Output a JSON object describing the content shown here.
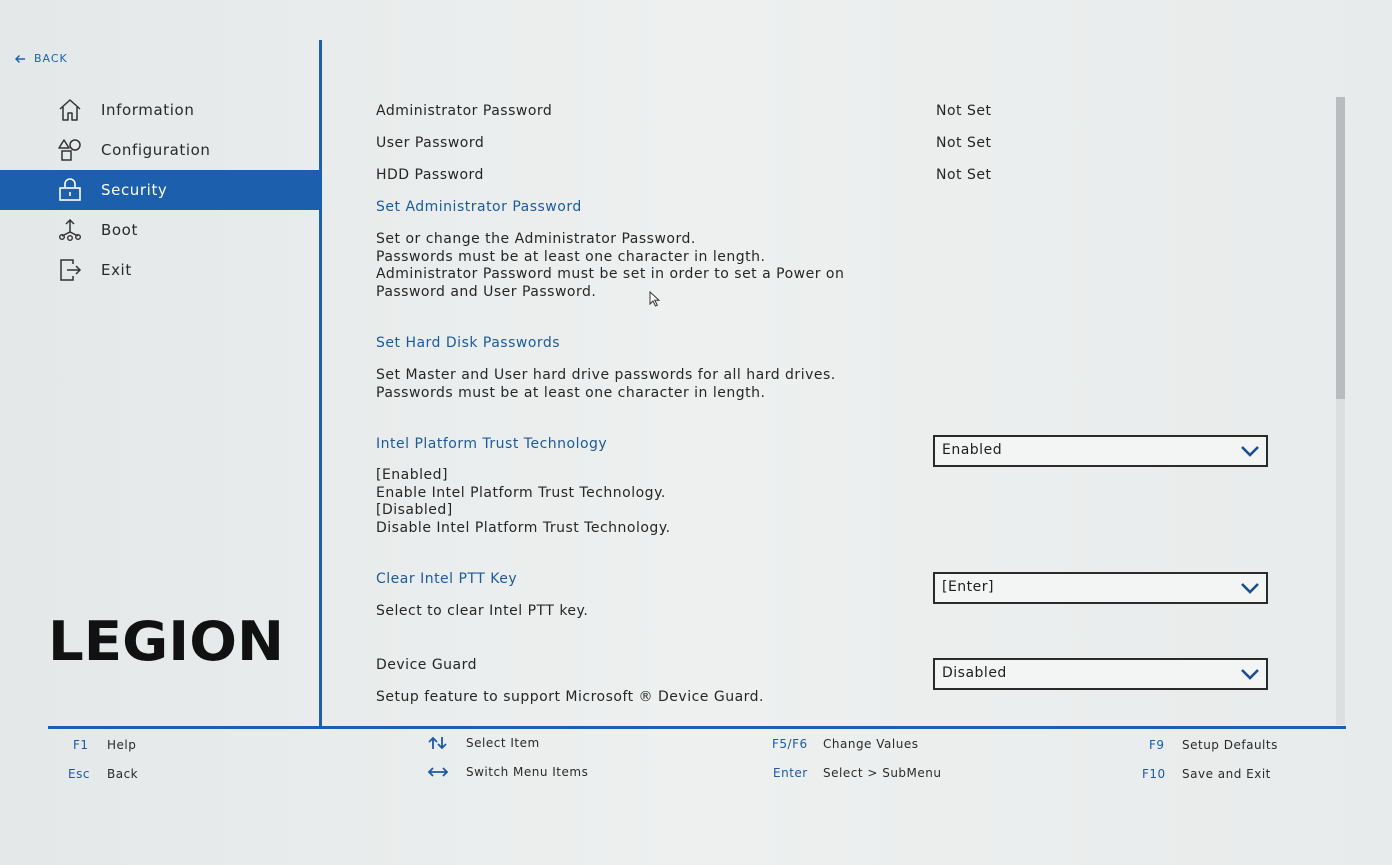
{
  "back": {
    "label": "BACK"
  },
  "sidebar": {
    "items": [
      {
        "label": "Information",
        "icon": "home-icon",
        "active": false
      },
      {
        "label": "Configuration",
        "icon": "shapes-icon",
        "active": false
      },
      {
        "label": "Security",
        "icon": "lock-icon",
        "active": true
      },
      {
        "label": "Boot",
        "icon": "boot-icon",
        "active": false
      },
      {
        "label": "Exit",
        "icon": "exit-icon",
        "active": false
      }
    ]
  },
  "logo": {
    "text": "LEGION"
  },
  "main": {
    "admin_password": {
      "label": "Administrator Password",
      "value": "Not Set"
    },
    "user_password": {
      "label": "User Password",
      "value": "Not Set"
    },
    "hdd_password": {
      "label": "HDD Password",
      "value": "Not Set"
    },
    "set_admin": {
      "label": "Set Administrator Password",
      "desc": [
        "Set or change the Administrator Password.",
        "Passwords must be at least one character in length.",
        "Administrator Password must be set in order to set a Power on",
        "Password and User Password."
      ]
    },
    "set_hdd": {
      "label": "Set Hard Disk Passwords",
      "desc": [
        "Set Master and User hard drive passwords for all hard drives.",
        "Passwords must be at least one character in length."
      ]
    },
    "ptt": {
      "label": "Intel Platform Trust Technology",
      "value": "Enabled",
      "desc": [
        "[Enabled]",
        "Enable Intel Platform Trust Technology.",
        "[Disabled]",
        "Disable Intel Platform Trust Technology."
      ]
    },
    "clear_ptt": {
      "label": "Clear Intel PTT Key",
      "value": "[Enter]",
      "desc": [
        "Select to clear Intel PTT key."
      ]
    },
    "device_guard": {
      "label": "Device Guard",
      "value": "Disabled",
      "desc": [
        "Setup feature to support Microsoft ® Device Guard."
      ]
    }
  },
  "footer": {
    "f1": {
      "key": "F1",
      "label": "Help"
    },
    "esc": {
      "key": "Esc",
      "label": "Back"
    },
    "select_item": {
      "label": "Select Item",
      "icon": "up-down-arrows-icon"
    },
    "switch_menu": {
      "label": "Switch Menu Items",
      "icon": "left-right-arrows-icon"
    },
    "f5f6": {
      "key": "F5/F6",
      "label": "Change Values"
    },
    "enter": {
      "key": "Enter",
      "label": "Select > SubMenu"
    },
    "f9": {
      "key": "F9",
      "label": "Setup Defaults"
    },
    "f10": {
      "key": "F10",
      "label": "Save and Exit"
    }
  },
  "colors": {
    "accent": "#1b5fad",
    "link": "#1a5a9e",
    "background": "#e9ecec"
  }
}
